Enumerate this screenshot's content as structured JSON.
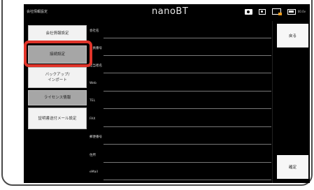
{
  "topbar": {
    "title": "会社情報設定",
    "logo": "nanoBT",
    "battery_value": "00.0v"
  },
  "menu": {
    "items": [
      {
        "label": "会社情報設定",
        "selected": false
      },
      {
        "label": "接続設定",
        "selected": true
      },
      {
        "label": "バックアップ/",
        "label2": "インポート",
        "selected": false
      },
      {
        "label": "ライセンス情報",
        "selected": true
      },
      {
        "label": "証明書送付メール設定",
        "selected": false
      }
    ]
  },
  "form": {
    "fields": [
      {
        "label": "会社名"
      },
      {
        "label": "会員番号"
      },
      {
        "label": "担当者名"
      },
      {
        "label": "Web"
      },
      {
        "label": "TEL"
      },
      {
        "label": "FAX"
      },
      {
        "label": "郵便番号"
      },
      {
        "label": "住所"
      },
      {
        "label": "eMail"
      }
    ]
  },
  "side": {
    "back_label": "戻る",
    "confirm_label": "確定"
  },
  "colors": {
    "highlight": "#e0342a",
    "selected_button": "#a6a6a6",
    "screen_background": "#000000"
  }
}
